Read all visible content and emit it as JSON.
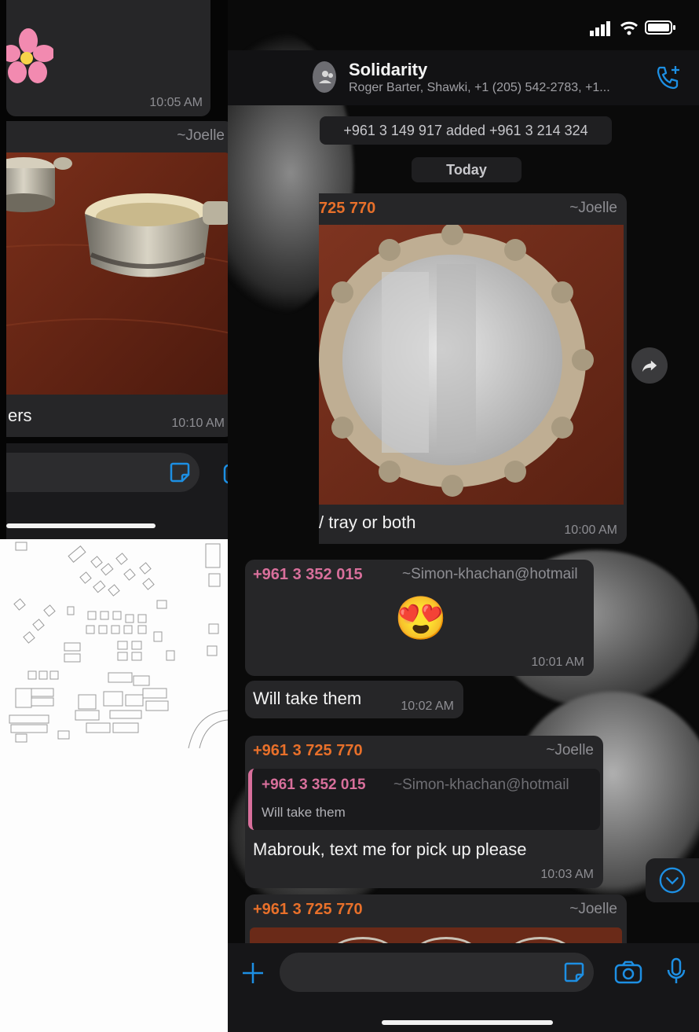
{
  "status_bar": {
    "signal_icon": "signal-icon",
    "wifi_icon": "wifi-icon",
    "battery_icon": "battery-icon"
  },
  "header": {
    "title": "Solidarity",
    "subtitle": "Roger Barter, Shawki, +1 (205) 542-2783, +1...",
    "avatar_icon": "group-avatar-icon",
    "call_icon": "add-call-icon"
  },
  "system": {
    "added_text": "+961 3 149 917 added +961 3 214 324",
    "date_divider": "Today"
  },
  "left_panel": {
    "msg1_time": "10:05 AM",
    "msg2_alias": "~Joelle",
    "msg2_caption": "ers",
    "msg2_time": "10:10 AM"
  },
  "messages": {
    "m1": {
      "sender": "725 770",
      "alias": "~Joelle",
      "caption": "/ tray or both",
      "time": "10:00 AM"
    },
    "m2": {
      "sender": "+961 3 352 015",
      "alias": "~Simon-khachan@hotmail",
      "emoji": "😍",
      "time": "10:01 AM"
    },
    "m3": {
      "text": "Will take them",
      "time": "10:02 AM"
    },
    "m4": {
      "sender": "+961 3 725 770",
      "alias": "~Joelle",
      "quote_sender": "+961 3 352 015",
      "quote_alias": "~Simon-khachan@hotmail",
      "quote_text": "Will take them",
      "text": "Mabrouk, text me for pick up please",
      "time": "10:03 AM"
    },
    "m5": {
      "sender": "+961 3 725 770",
      "alias": "~Joelle"
    }
  },
  "composer": {
    "plus_icon": "plus-icon",
    "sticker_icon": "sticker-icon",
    "camera_icon": "camera-icon",
    "mic_icon": "mic-icon"
  },
  "colors": {
    "accent": "#1d8fe3",
    "orange_sender": "#e8702a",
    "pink_sender": "#d86f9b",
    "bubble": "#262628"
  }
}
